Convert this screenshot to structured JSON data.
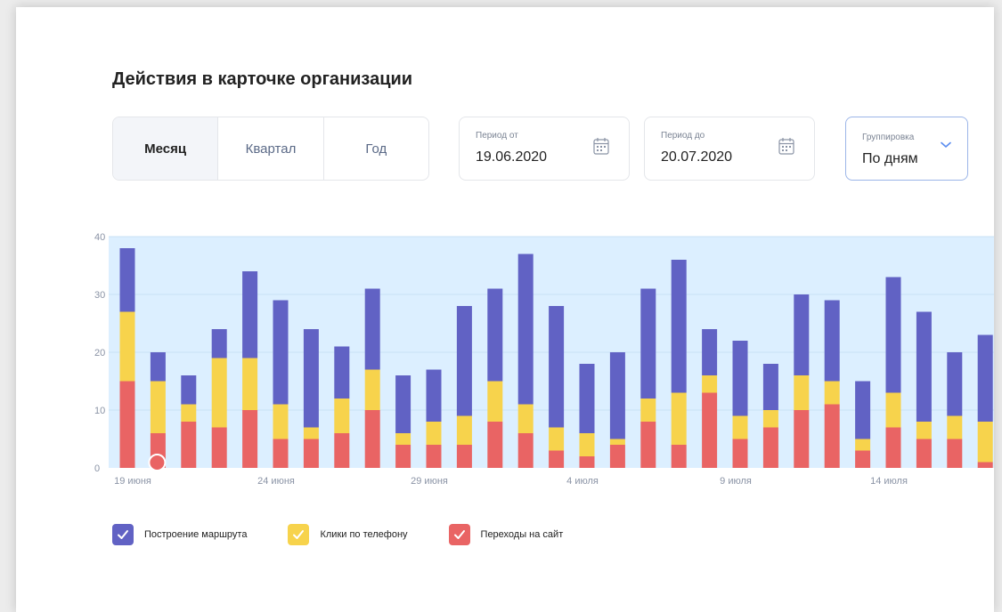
{
  "header": {
    "title": "Действия в карточке организации"
  },
  "period_tabs": [
    {
      "label": "Месяц",
      "active": true
    },
    {
      "label": "Квартал",
      "active": false
    },
    {
      "label": "Год",
      "active": false
    }
  ],
  "period_from": {
    "caption": "Период от",
    "value": "19.06.2020",
    "icon": "calendar-icon"
  },
  "period_to": {
    "caption": "Период до",
    "value": "20.07.2020",
    "icon": "calendar-icon"
  },
  "grouping": {
    "caption": "Группировка",
    "value": "По дням",
    "icon": "chevron-down-icon"
  },
  "colors": {
    "route": "#6162c4",
    "phone": "#f7d34c",
    "site": "#e96464",
    "plot_bg": "#dcefff",
    "accent": "#5a8cf0"
  },
  "legend": [
    {
      "label": "Построение маршрута",
      "color": "#6162c4"
    },
    {
      "label": "Клики по телефону",
      "color": "#f7d34c"
    },
    {
      "label": "Переходы на сайт",
      "color": "#e96464"
    }
  ],
  "chart_data": {
    "type": "bar",
    "stacked": true,
    "ylim": [
      0,
      40
    ],
    "yticks": [
      0,
      10,
      20,
      30,
      40
    ],
    "xtick_labels": [
      {
        "index": 0,
        "label": "19 июня"
      },
      {
        "index": 5,
        "label": "24 июня"
      },
      {
        "index": 10,
        "label": "29 июня"
      },
      {
        "index": 15,
        "label": "4 июля"
      },
      {
        "index": 20,
        "label": "9 июля"
      },
      {
        "index": 25,
        "label": "14 июля"
      }
    ],
    "series": [
      {
        "name": "Переходы на сайт",
        "color": "#e96464",
        "values": [
          15,
          6,
          8,
          7,
          10,
          5,
          5,
          6,
          10,
          4,
          4,
          4,
          8,
          6,
          3,
          2,
          4,
          8,
          4,
          13,
          5,
          7,
          10,
          11,
          3,
          7,
          5,
          5,
          1
        ]
      },
      {
        "name": "Клики по телефону",
        "color": "#f7d34c",
        "values": [
          12,
          9,
          3,
          12,
          9,
          6,
          2,
          6,
          7,
          2,
          4,
          5,
          7,
          5,
          4,
          4,
          1,
          4,
          9,
          3,
          4,
          3,
          6,
          4,
          2,
          6,
          3,
          4,
          7
        ]
      },
      {
        "name": "Построение маршрута",
        "color": "#6162c4",
        "values": [
          11,
          5,
          5,
          5,
          15,
          18,
          17,
          9,
          14,
          10,
          9,
          19,
          16,
          26,
          21,
          12,
          15,
          19,
          23,
          8,
          13,
          8,
          14,
          14,
          10,
          20,
          19,
          11,
          15
        ]
      }
    ]
  }
}
